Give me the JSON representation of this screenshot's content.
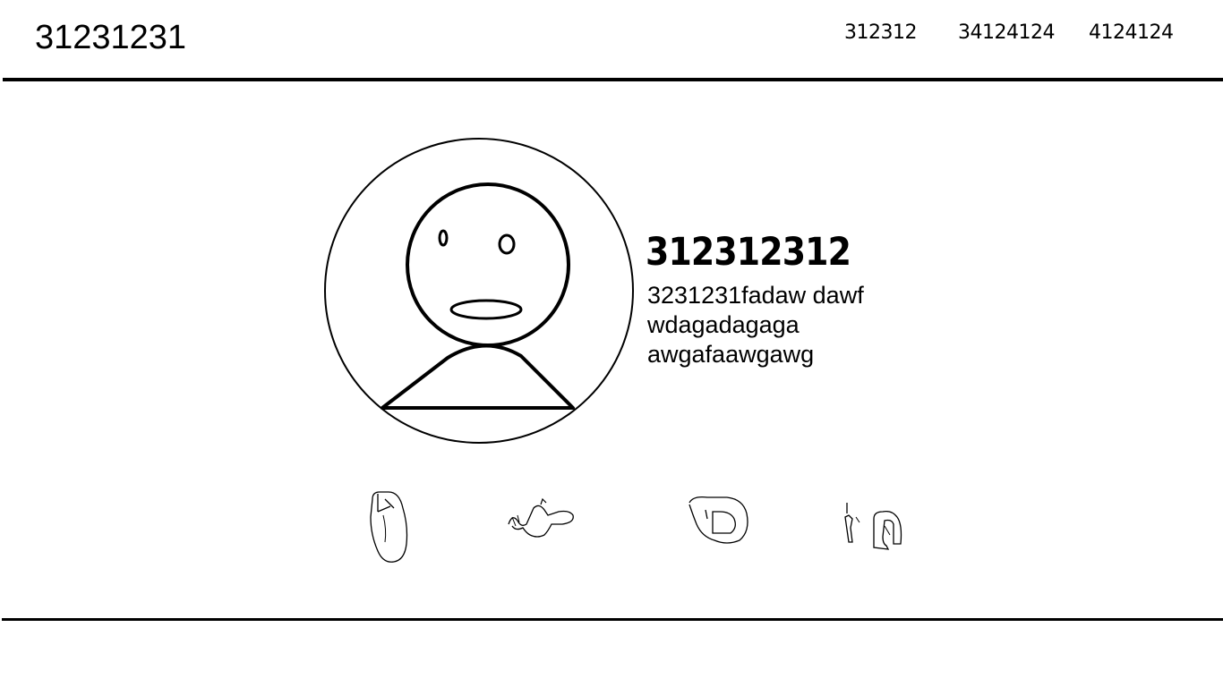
{
  "header": {
    "title": "31231231",
    "nav": [
      {
        "label": "312312"
      },
      {
        "label": "34124124"
      },
      {
        "label": "4124124"
      }
    ]
  },
  "profile": {
    "name": "312312312",
    "bio_lines": [
      "3231231fadaw dawf",
      "wdagadagaga",
      "awgafaawgawg"
    ]
  },
  "social_icons": [
    {
      "icon": "mouse-icon"
    },
    {
      "icon": "bird-icon"
    },
    {
      "icon": "d-logo-icon"
    },
    {
      "icon": "in-logo-icon"
    }
  ],
  "colors": {
    "background": "#ffffff",
    "foreground": "#000000"
  }
}
